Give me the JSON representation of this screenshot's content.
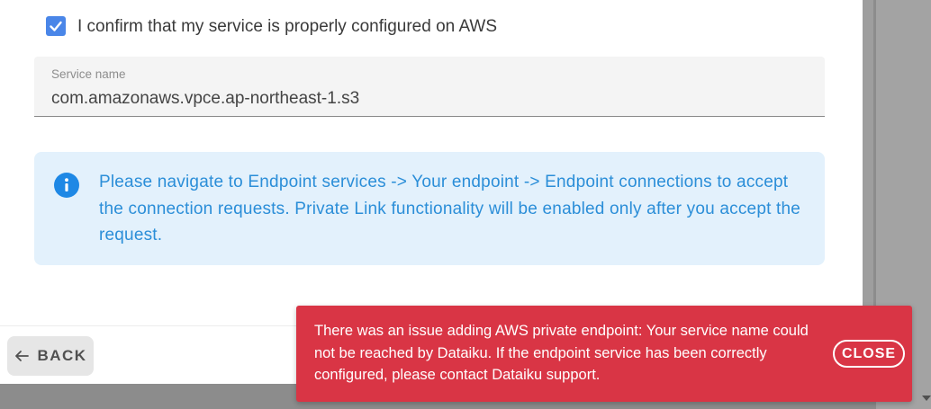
{
  "form": {
    "confirm_checkbox": {
      "checked": true,
      "label": "I confirm that my service is properly configured on AWS"
    },
    "service_name": {
      "label": "Service name",
      "value": "com.amazonaws.vpce.ap-northeast-1.s3"
    }
  },
  "info_notice": {
    "icon": "info-icon",
    "text": "Please navigate to Endpoint services -> Your endpoint -> Endpoint connections to accept the connection requests. Private Link functionality will be enabled only after you accept the request."
  },
  "footer": {
    "back_icon": "arrow-left-icon",
    "back_label": "BACK"
  },
  "error_toast": {
    "message": "There was an issue adding AWS private endpoint: Your service name could not be reached by Dataiku. If the endpoint service has been correctly configured, please contact Dataiku support.",
    "close_label": "CLOSE"
  },
  "colors": {
    "checkbox": "#4a86e8",
    "info_background": "#e3f1fc",
    "info_text": "#2b8ed8",
    "toast_background": "#d93545"
  }
}
